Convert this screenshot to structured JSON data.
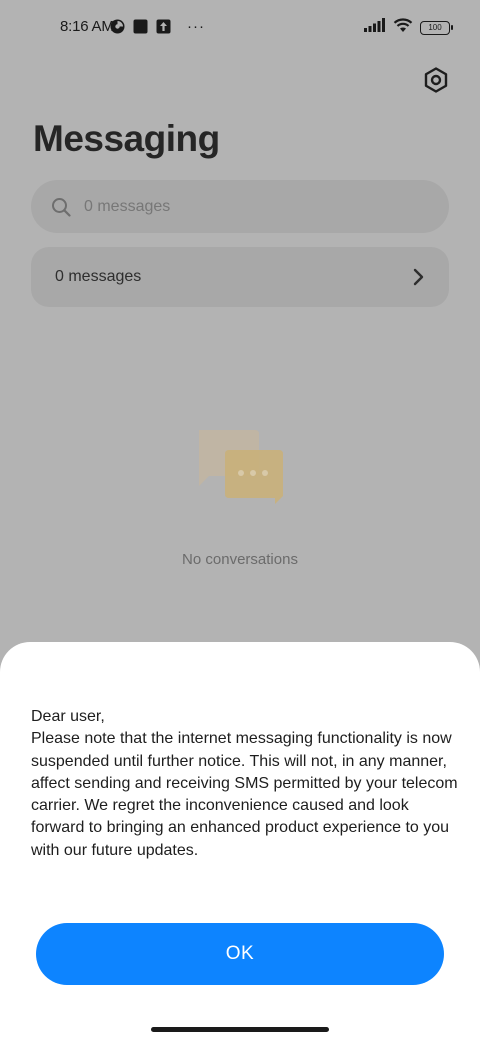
{
  "status_bar": {
    "time": "8:16 AM",
    "overflow": "···",
    "battery": "100",
    "icons": [
      "timer-icon",
      "square-notification-icon",
      "upload-notification-icon",
      "signal-icon",
      "wifi-icon",
      "battery-icon"
    ]
  },
  "header": {
    "title": "Messaging",
    "settings_icon": "settings-icon"
  },
  "search": {
    "placeholder": "0 messages",
    "icon": "search-icon"
  },
  "messages_row": {
    "label": "0 messages",
    "icon": "chevron-right-icon"
  },
  "empty_state": {
    "text": "No conversations",
    "icon": "chat-bubbles-icon"
  },
  "dialog": {
    "greeting": "Dear user,",
    "body": "Please note that the internet messaging functionality is now suspended until further notice. This will not, in any manner, affect sending and receiving SMS permitted by your telecom carrier. We regret the inconvenience caused and look forward to bringing an enhanced product experience to you with our future updates.",
    "ok_label": "OK"
  },
  "colors": {
    "overlay_background": "#b3b3b3",
    "sheet_background": "#ffffff",
    "accent": "#0d84ff"
  }
}
